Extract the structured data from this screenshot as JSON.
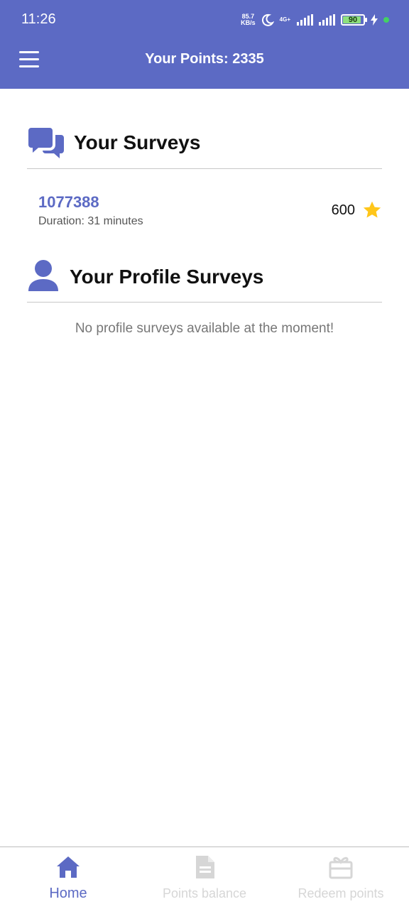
{
  "status_bar": {
    "time": "11:26",
    "net_speed_value": "85.7",
    "net_speed_unit": "KB/s",
    "network_type": "4G+",
    "battery_percent": "90",
    "battery_level": 0.9
  },
  "app_bar": {
    "title": "Your Points: 2335"
  },
  "surveys_section": {
    "title": "Your Surveys",
    "icon": "chat-bubbles-icon",
    "items": [
      {
        "id": "1077388",
        "duration": "Duration: 31 minutes",
        "points": "600"
      }
    ]
  },
  "profile_section": {
    "title": "Your Profile Surveys",
    "icon": "user-icon",
    "empty_message": "No profile surveys available at the moment!"
  },
  "bottom_nav": {
    "items": [
      {
        "label": "Home",
        "icon": "home-icon",
        "active": true
      },
      {
        "label": "Points balance",
        "icon": "document-icon",
        "active": false
      },
      {
        "label": "Redeem points",
        "icon": "gift-icon",
        "active": false
      }
    ]
  },
  "colors": {
    "primary": "#5c6ac4",
    "star": "#ffc61a",
    "inactive_nav": "#d6d6d6",
    "battery_fill": "#8de07d"
  }
}
